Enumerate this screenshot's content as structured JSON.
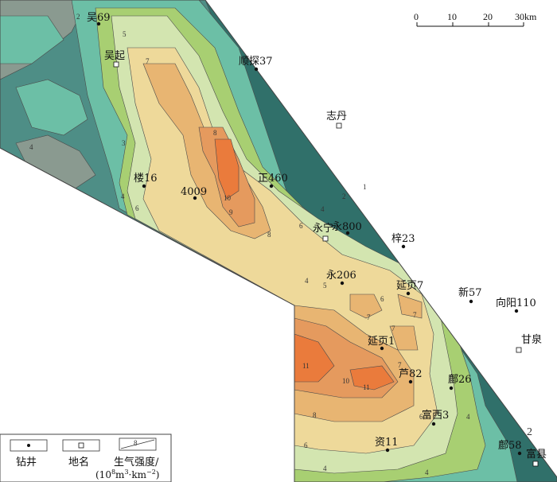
{
  "scale_bar": {
    "ticks": [
      "0",
      "10",
      "20",
      "30km"
    ]
  },
  "wells": [
    {
      "id": "wuqi69",
      "name": "吴69"
    },
    {
      "id": "shun37",
      "name": "顺探37"
    },
    {
      "id": "lou16",
      "name": "楼16"
    },
    {
      "id": "w4009",
      "name": "4009"
    },
    {
      "id": "zheng460",
      "name": "正460"
    },
    {
      "id": "yong800",
      "name": "永800"
    },
    {
      "id": "zi23",
      "name": "梓23"
    },
    {
      "id": "yong206",
      "name": "永206"
    },
    {
      "id": "yanye7",
      "name": "延页7"
    },
    {
      "id": "xin57",
      "name": "新57"
    },
    {
      "id": "xiang110",
      "name": "向阳110"
    },
    {
      "id": "yanye1",
      "name": "延页1"
    },
    {
      "id": "lu82",
      "name": "芦82"
    },
    {
      "id": "fu26",
      "name": "鄜26"
    },
    {
      "id": "fuxi3",
      "name": "富西3"
    },
    {
      "id": "zi11",
      "name": "资11"
    },
    {
      "id": "fu58",
      "name": "鄜58"
    }
  ],
  "places": [
    {
      "id": "wuqi",
      "name": "吴起"
    },
    {
      "id": "zhidan",
      "name": "志丹"
    },
    {
      "id": "yongning",
      "name": "永宁"
    },
    {
      "id": "ganquan",
      "name": "甘泉"
    },
    {
      "id": "fuxian",
      "name": "富县"
    }
  ],
  "contour_labels": [
    {
      "id": "c-wuqi-2",
      "value": "2"
    },
    {
      "id": "c-wuqi-5",
      "value": "5"
    },
    {
      "id": "c-wuqi-7",
      "value": "7"
    },
    {
      "id": "c-left-4",
      "value": "4"
    },
    {
      "id": "c-left-3",
      "value": "3"
    },
    {
      "id": "c-mid-8",
      "value": "8"
    },
    {
      "id": "c-mid-10",
      "value": "10"
    },
    {
      "id": "c-mid-9",
      "value": "9"
    },
    {
      "id": "c-mid-8b",
      "value": "8"
    },
    {
      "id": "c-lou-4",
      "value": "4"
    },
    {
      "id": "c-lou-6",
      "value": "6"
    },
    {
      "id": "c-zd-1",
      "value": "1"
    },
    {
      "id": "c-zd-2",
      "value": "2"
    },
    {
      "id": "c-yn-4",
      "value": "4"
    },
    {
      "id": "c-yn-6",
      "value": "6"
    },
    {
      "id": "c-y206-4",
      "value": "4"
    },
    {
      "id": "c-y206-5",
      "value": "5"
    },
    {
      "id": "c-yy-6",
      "value": "6"
    },
    {
      "id": "c-yy-7a",
      "value": "7"
    },
    {
      "id": "c-yy-7b",
      "value": "7"
    },
    {
      "id": "c-yy-7c",
      "value": "7"
    },
    {
      "id": "c-yy-7d",
      "value": "7"
    },
    {
      "id": "c-s-11a",
      "value": "11"
    },
    {
      "id": "c-s-10",
      "value": "10"
    },
    {
      "id": "c-s-11b",
      "value": "11"
    },
    {
      "id": "c-s-8",
      "value": "8"
    },
    {
      "id": "c-s-6",
      "value": "6"
    },
    {
      "id": "c-s-4a",
      "value": "4"
    },
    {
      "id": "c-s-4b",
      "value": "4"
    },
    {
      "id": "c-s-4c",
      "value": "4"
    },
    {
      "id": "c-s-6b",
      "value": "6"
    },
    {
      "id": "c-fx-2",
      "value": "2"
    }
  ],
  "legend": {
    "well": "钻井",
    "place": "地名",
    "strength_title": "生气强度/",
    "strength_unit_prefix": "(10",
    "strength_unit_sup1": "8",
    "strength_unit_mid": "m",
    "strength_unit_sup2": "3",
    "strength_unit_mid2": "·km",
    "strength_unit_sup3": "−2",
    "strength_unit_suffix": ")",
    "sample_value": "8"
  },
  "colors": {
    "level_0": "#3a5c9c",
    "level_1": "#30706a",
    "level_2": "#4e8e86",
    "level_3": "#6cbfa6",
    "level_4": "#8a9a90",
    "level_5": "#a8cf72",
    "level_6": "#d3e5b0",
    "level_7": "#eed99a",
    "level_8": "#e8b572",
    "level_9": "#e59a5e",
    "level_10": "#ea7b3c",
    "blank": "#ffffff"
  }
}
